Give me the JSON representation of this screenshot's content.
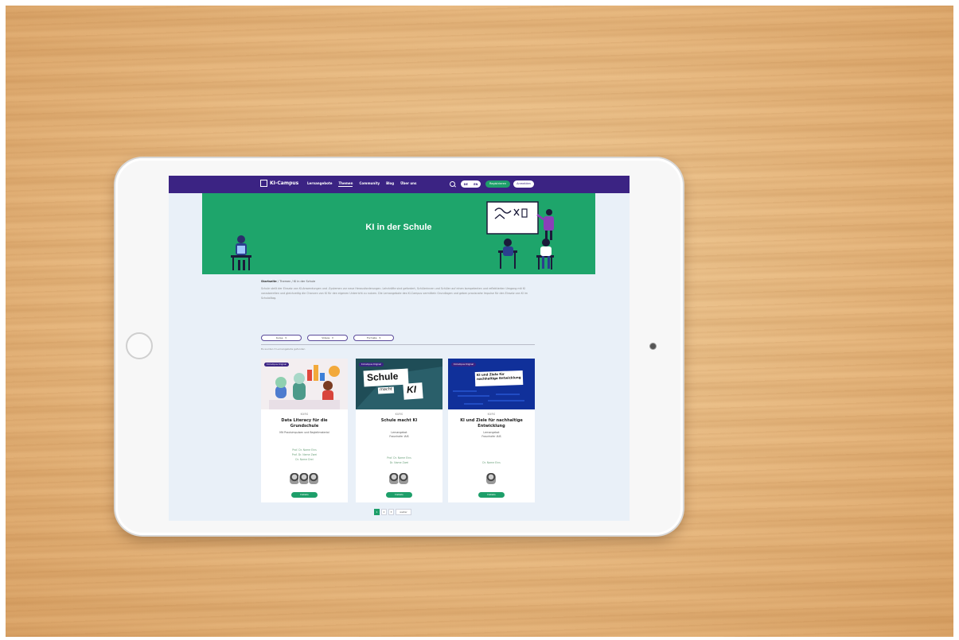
{
  "nav": {
    "logo_text": "KI-Campus",
    "links": [
      "Lernangebote",
      "Themen",
      "Community",
      "Blog",
      "Über uns"
    ],
    "active_index": 1,
    "toggle": [
      "DE",
      "EN"
    ],
    "register_label": "Registrieren",
    "login_label": "Anmelden"
  },
  "hero": {
    "title": "KI in der Schule"
  },
  "breadcrumb": [
    "Startseite",
    "Themen",
    "KI in der Schule"
  ],
  "intro_text": "Schule stellt der Einsatz von KI-Anwendungen und -Systemen vor neue Herausforderungen. Lehrkräfte sind gefordert, Schülerinnen und Schüler auf einen kompetenten und reflektierten Umgang mit KI vorzubereiten und gleichzeitig die Chancen von KI für den eigenen Unterricht zu nutzen. Die Lernangebote des KI-Campus vermitteln Grundlagen und geben praxisnahe Impulse für den Einsatz von KI im Schulalltag.",
  "filters": [
    "Kurse",
    "Videos",
    "Formate"
  ],
  "results_count": "Es wurden 3 Lernangebote gefunden",
  "cards": [
    {
      "tag": "KI-Campus Original",
      "type": "KURS",
      "title": "Data Literacy für die Grundschule",
      "meta": [
        "Mit Praxisimpulsen und Begleitmaterial"
      ],
      "people": [
        "Prof. Dr. Name Eins",
        "Prof. Dr. Name Zwei",
        "Dr. Name Drei"
      ],
      "button": "Details"
    },
    {
      "tag": "KI-Campus Original",
      "type": "KURS",
      "title": "Schule macht KI",
      "image_text": [
        "Schule",
        "macht",
        "KI"
      ],
      "meta": [
        "Lernangebot",
        "Fraunhofer IAIS"
      ],
      "people": [
        "Prof. Dr. Name Eins",
        "Dr. Name Zwei"
      ],
      "button": "Details"
    },
    {
      "tag": "KI-Campus Original",
      "type": "KURS",
      "title": "KI und Ziele für nachhaltige Entwicklung",
      "image_text": [
        "KI und Ziele für nachhaltige Entwicklung"
      ],
      "meta": [
        "Lernangebot",
        "Fraunhofer IAIS"
      ],
      "people": [
        "Dr. Name Eins"
      ],
      "button": "Details"
    }
  ],
  "pagination": {
    "pages": [
      "1",
      "2",
      "3"
    ],
    "next": "weiter"
  },
  "colors": {
    "brand_purple": "#3b2383",
    "brand_green": "#1ea56b",
    "button_green": "#1e9f6a"
  }
}
